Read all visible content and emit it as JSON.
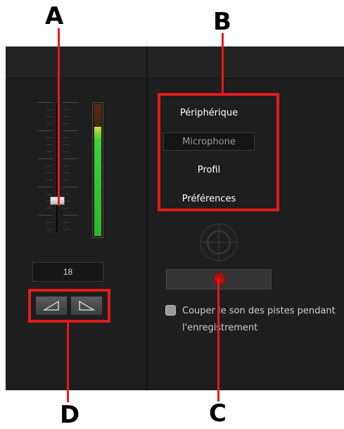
{
  "annotations": {
    "a": "A",
    "b": "B",
    "c": "C",
    "d": "D"
  },
  "colors": {
    "panel_bg": "#1e1e1e",
    "highlight_red": "#e21b1b",
    "vu_green": "#2bb52b",
    "record_red": "#b01414"
  },
  "volume": {
    "value": "18",
    "fader_level": 0.2,
    "meter_level": 0.82
  },
  "menu": {
    "items": [
      "Périphérique",
      "Microphone",
      "Profil",
      "Préférences"
    ],
    "selected": "Microphone"
  },
  "direction_buttons": {
    "icons": [
      "fade-in-icon",
      "fade-out-icon"
    ]
  },
  "record": {
    "icon": "record-icon",
    "target_icon": "crosshair-target-icon"
  },
  "option": {
    "checked": false,
    "label": "Couper le son des pistes pendant\nl'enregistrement"
  }
}
